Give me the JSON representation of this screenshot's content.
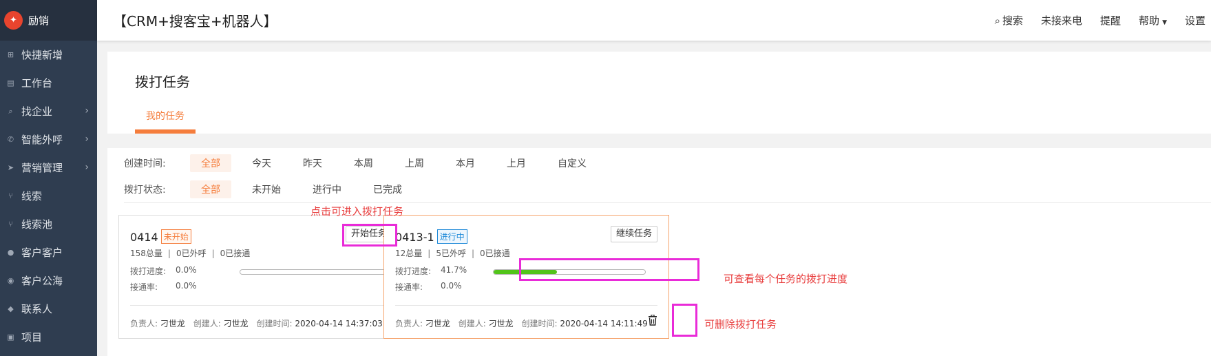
{
  "sidebar": {
    "brand": "励销",
    "items": [
      {
        "label": "快捷新增",
        "icon": "plus-square-icon",
        "glyph": "⊞",
        "has_submenu": false
      },
      {
        "label": "工作台",
        "icon": "desktop-icon",
        "glyph": "▤",
        "has_submenu": false
      },
      {
        "label": "找企业",
        "icon": "search-icon",
        "glyph": "⌕",
        "has_submenu": true
      },
      {
        "label": "智能外呼",
        "icon": "phone-icon",
        "glyph": "✆",
        "has_submenu": true
      },
      {
        "label": "营销管理",
        "icon": "send-icon",
        "glyph": "➤",
        "has_submenu": true
      },
      {
        "label": "线索",
        "icon": "branch-icon",
        "glyph": "⑂",
        "has_submenu": false
      },
      {
        "label": "线索池",
        "icon": "branch-pool-icon",
        "glyph": "⑂",
        "has_submenu": false
      },
      {
        "label": "客户客户",
        "icon": "user-icon",
        "glyph": "●",
        "has_submenu": false
      },
      {
        "label": "客户公海",
        "icon": "users-icon",
        "glyph": "◉",
        "has_submenu": false
      },
      {
        "label": "联系人",
        "icon": "chat-icon",
        "glyph": "◆",
        "has_submenu": false
      },
      {
        "label": "项目",
        "icon": "folder-icon",
        "glyph": "▣",
        "has_submenu": false
      }
    ]
  },
  "topbar": {
    "title": "【CRM+搜客宝+机器人】",
    "search": "搜索",
    "missed_calls": "未接来电",
    "reminders": "提醒",
    "help": "帮助",
    "settings": "设置"
  },
  "page": {
    "title": "拨打任务",
    "tab": "我的任务"
  },
  "filters": {
    "created_label": "创建时间:",
    "created_options": [
      "全部",
      "今天",
      "昨天",
      "本周",
      "上周",
      "本月",
      "上月",
      "自定义"
    ],
    "created_selected": 0,
    "status_label": "拨打状态:",
    "status_options": [
      "全部",
      "未开始",
      "进行中",
      "已完成"
    ],
    "status_selected": 0
  },
  "tasks": [
    {
      "name": "0414",
      "status": "未开始",
      "total": "158总量",
      "called": "0已外呼",
      "connected": "0已接通",
      "progress_label": "拨打进度:",
      "progress": "0.0%",
      "progress_value": 0.0,
      "rate_label": "接通率:",
      "rate": "0.0%",
      "owner_label": "负责人:",
      "owner": "刁世龙",
      "creator_label": "创建人:",
      "creator": "刁世龙",
      "created_label": "创建时间:",
      "created_at": "2020-04-14 14:37:03",
      "action": "开始任务"
    },
    {
      "name": "0413-1",
      "status": "进行中",
      "total": "12总量",
      "called": "5已外呼",
      "connected": "0已接通",
      "progress_label": "拨打进度:",
      "progress": "41.7%",
      "progress_value": 0.417,
      "rate_label": "接通率:",
      "rate": "0.0%",
      "owner_label": "负责人:",
      "owner": "刁世龙",
      "creator_label": "创建人:",
      "creator": "刁世龙",
      "created_label": "创建时间:",
      "created_at": "2020-04-14 14:11:49",
      "action": "继续任务"
    }
  ],
  "annotations": {
    "enter_task": "点击可进入拨打任务",
    "view_progress": "可查看每个任务的拨打进度",
    "delete_task": "可删除拨打任务"
  },
  "colors": {
    "accent": "#f57d3c",
    "sidebar": "#2f3d50",
    "progress": "#52c41a",
    "highlight": "#e92bd8",
    "annotation": "#e83c3c"
  }
}
